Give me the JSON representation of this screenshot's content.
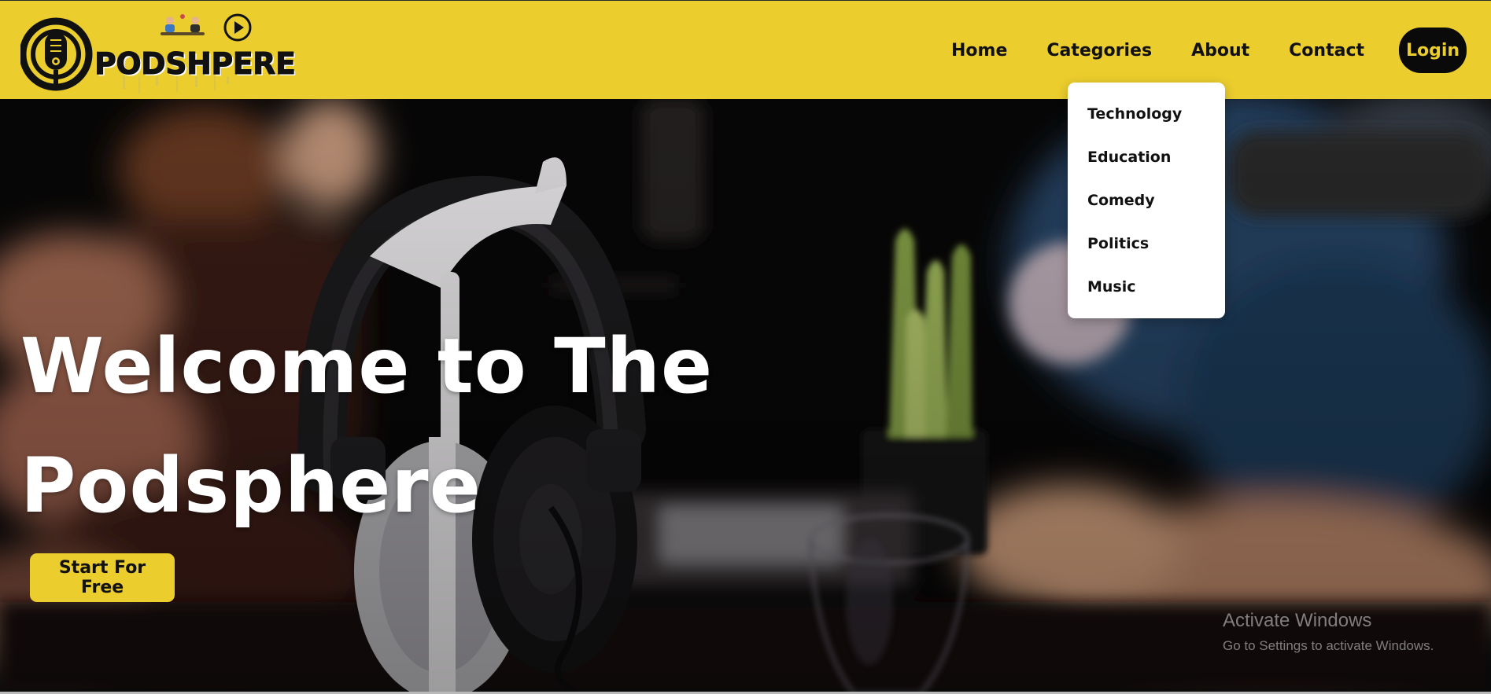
{
  "brand": {
    "name": "PODSHPERE"
  },
  "nav": {
    "items": [
      {
        "label": "Home"
      },
      {
        "label": "Categories"
      },
      {
        "label": "About"
      },
      {
        "label": "Contact"
      }
    ],
    "login_label": "Login"
  },
  "categories_menu": {
    "items": [
      {
        "label": "Technology"
      },
      {
        "label": "Education"
      },
      {
        "label": "Comedy"
      },
      {
        "label": "Politics"
      },
      {
        "label": "Music"
      }
    ]
  },
  "hero": {
    "title_line1": "Welcome to The",
    "title_line2": "Podsphere",
    "cta_label": "Start For Free"
  },
  "watermark": {
    "title": "Activate Windows",
    "subtitle": "Go to Settings to activate Windows."
  },
  "colors": {
    "accent": "#ebcd2e",
    "dark": "#0a0a0a",
    "white": "#ffffff"
  },
  "icons": {
    "logo": "microphone-icon",
    "logo_play": "play-circle-icon"
  }
}
